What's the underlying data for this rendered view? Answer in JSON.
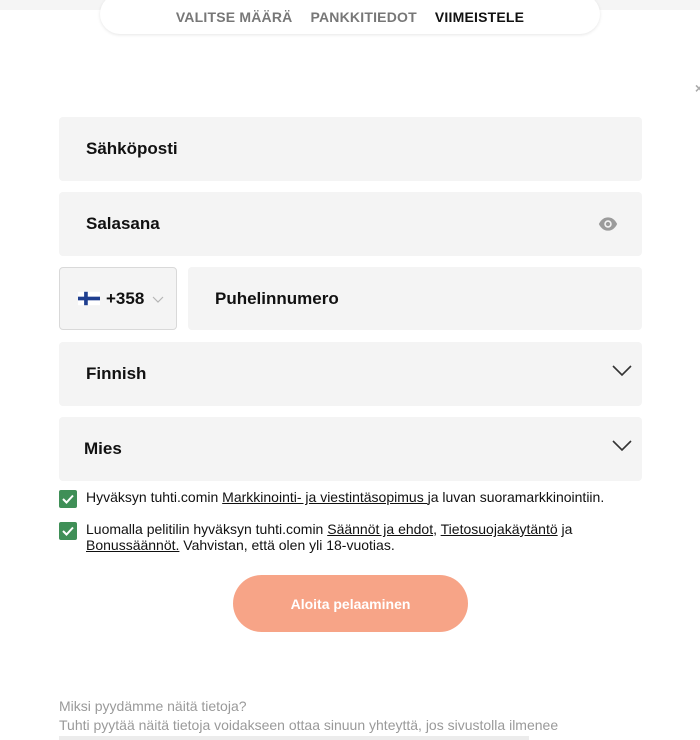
{
  "steps": {
    "step1": "VALITSE MÄÄRÄ",
    "step2": "PANKKITIEDOT",
    "step3": "VIIMEISTELE"
  },
  "close_symbol": "×",
  "form": {
    "email_label": "Sähköposti",
    "password_label": "Salasana",
    "country_code": "+358",
    "phone_label": "Puhelinnumero",
    "language_value": "Finnish",
    "gender_value": "Mies"
  },
  "consent1": {
    "checked": true,
    "text_before": "Hyväksyn tuhti.comin ",
    "link": "Markkinointi- ja viestintäsopimus ",
    "text_after": "ja luvan suoramarkkinointiin."
  },
  "consent2": {
    "checked": true,
    "text_before": "Luomalla pelitilin hyväksyn tuhti.comin ",
    "link1": "Säännöt ja ehdot",
    "sep": ", ",
    "link2": "Tietosuojakäytäntö",
    "and": " ja ",
    "link3": "Bonussäännöt.",
    "text_after": " Vahvistan, että olen yli 18-vuotias."
  },
  "cta_label": "Aloita pelaaminen",
  "info": {
    "title": "Miksi pyydämme näitä tietoja?",
    "body": "Tuhti pyytää näitä tietoja voidakseen ottaa sinuun yhteyttä, jos sivustolla ilmenee"
  },
  "icons": {
    "password_toggle": "eye-icon",
    "country_flag": "finland-flag-icon",
    "dropdown": "chevron-down-icon",
    "checkbox": "checkmark-icon"
  },
  "colors": {
    "cta_background": "#f7a487",
    "checkbox_green": "#3f8f57",
    "field_background": "#f4f4f4"
  }
}
